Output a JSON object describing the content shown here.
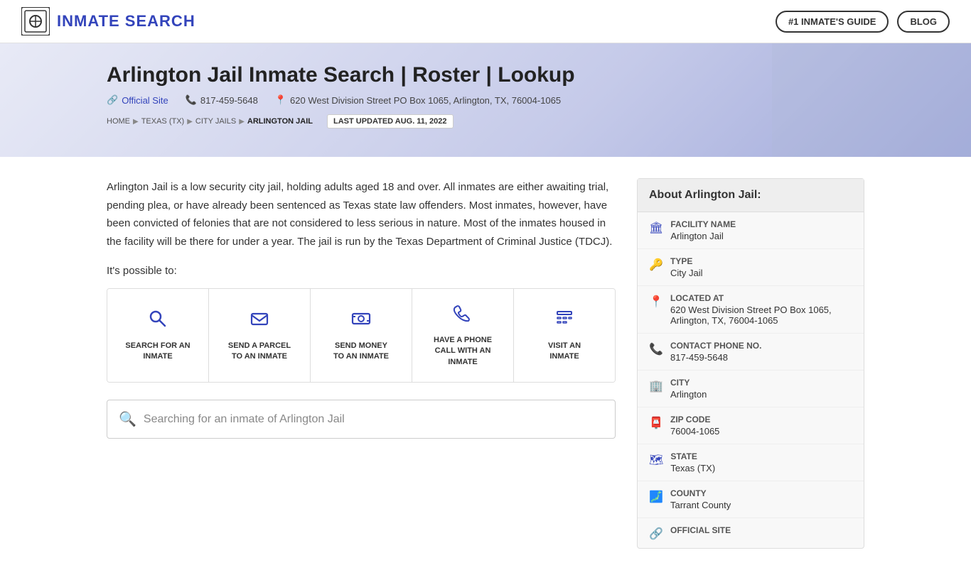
{
  "header": {
    "logo_text": "INMATE SEARCH",
    "nav_guide_label": "#1 INMATE'S GUIDE",
    "nav_blog_label": "BLOG"
  },
  "hero": {
    "title": "Arlington Jail Inmate Search | Roster | Lookup",
    "official_site_label": "Official Site",
    "phone": "817-459-5648",
    "address": "620 West Division Street PO Box 1065, Arlington, TX, 76004-1065",
    "breadcrumb": {
      "home": "HOME",
      "state": "TEXAS (TX)",
      "category": "CITY JAILS",
      "current": "ARLINGTON JAIL"
    },
    "last_updated": "LAST UPDATED AUG. 11, 2022"
  },
  "main": {
    "description": "Arlington Jail is a low security city jail, holding adults aged 18 and over. All inmates are either awaiting trial, pending plea, or have already been sentenced as Texas state law offenders. Most inmates, however, have been convicted of felonies that are not considered to less serious in nature. Most of the inmates housed in the facility will be there for under a year. The jail is run by the Texas Department of Criminal Justice (TDCJ).",
    "possible_label": "It's possible to:",
    "action_cards": [
      {
        "id": "search",
        "icon": "search",
        "label": "SEARCH FOR AN INMATE"
      },
      {
        "id": "parcel",
        "icon": "parcel",
        "label": "SEND A PARCEL TO AN INMATE"
      },
      {
        "id": "money",
        "icon": "money",
        "label": "SEND MONEY TO AN INMATE"
      },
      {
        "id": "phone",
        "icon": "phone",
        "label": "HAVE A PHONE CALL WITH AN INMATE"
      },
      {
        "id": "visit",
        "icon": "visit",
        "label": "VISIT AN INMATE"
      }
    ],
    "search_placeholder": "Searching for an inmate of Arlington Jail"
  },
  "sidebar": {
    "title": "About Arlington Jail:",
    "rows": [
      {
        "icon": "building",
        "label": "Facility Name",
        "value": "Arlington Jail"
      },
      {
        "icon": "type",
        "label": "Type",
        "value": "City Jail"
      },
      {
        "icon": "location",
        "label": "Located At",
        "value": "620 West Division Street PO Box 1065, Arlington, TX, 76004-1065"
      },
      {
        "icon": "phone",
        "label": "Contact Phone No.",
        "value": "817-459-5648"
      },
      {
        "icon": "city",
        "label": "City",
        "value": "Arlington"
      },
      {
        "icon": "zip",
        "label": "ZIP Code",
        "value": "76004-1065"
      },
      {
        "icon": "state",
        "label": "State",
        "value": "Texas (TX)"
      },
      {
        "icon": "county",
        "label": "County",
        "value": "Tarrant County"
      },
      {
        "icon": "official",
        "label": "Official Site",
        "value": ""
      }
    ]
  }
}
